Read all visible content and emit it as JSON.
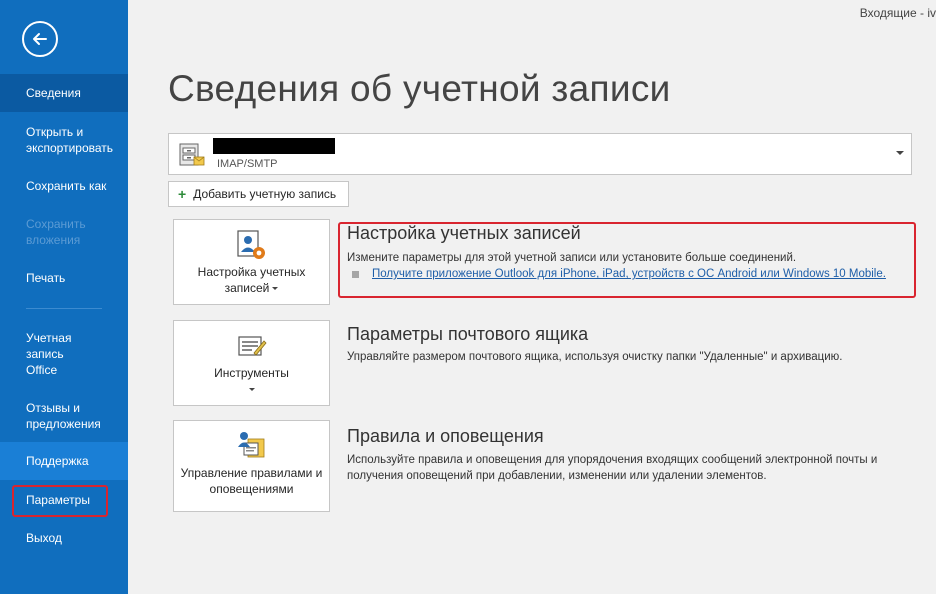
{
  "window": {
    "title": "Входящие - iv"
  },
  "sidebar": {
    "back_icon": "back-arrow-icon",
    "items": [
      {
        "label": "Сведения",
        "state": "selected"
      },
      {
        "label": "Открыть и экспортировать",
        "state": "normal"
      },
      {
        "label": "Сохранить как",
        "state": "normal"
      },
      {
        "label": "Сохранить вложения",
        "state": "disabled"
      },
      {
        "label": "Печать",
        "state": "normal"
      },
      {
        "label": "Учетная запись Office",
        "state": "normal"
      },
      {
        "label": "Отзывы и предложения",
        "state": "normal"
      },
      {
        "label": "Поддержка",
        "state": "hover"
      },
      {
        "label": "Параметры",
        "state": "highlighted"
      },
      {
        "label": "Выход",
        "state": "normal"
      }
    ]
  },
  "main": {
    "title": "Сведения об учетной записи",
    "account": {
      "type": "IMAP/SMTP"
    },
    "add_account_label": "Добавить учетную запись",
    "sections": [
      {
        "tile_label": "Настройка учетных записей",
        "title": "Настройка учетных записей",
        "description": "Измените параметры для этой учетной записи или установите больше соединений.",
        "link": "Получите приложение Outlook для iPhone, iPad, устройств с ОС Android или Windows 10 Mobile."
      },
      {
        "tile_label": "Инструменты",
        "title": "Параметры почтового ящика",
        "description": "Управляйте размером почтового ящика, используя очистку папки \"Удаленные\" и архивацию."
      },
      {
        "tile_label": "Управление правилами и оповещениями",
        "title": "Правила и оповещения",
        "description": "Используйте правила и оповещения для упорядочения входящих сообщений электронной почты и получения оповещений при добавлении, изменении или удалении элементов."
      }
    ]
  },
  "colors": {
    "sidebar": "#106ebe",
    "sidebar_selected": "#0b5aa2",
    "highlight": "#d9252f",
    "link": "#1e5ea8"
  }
}
